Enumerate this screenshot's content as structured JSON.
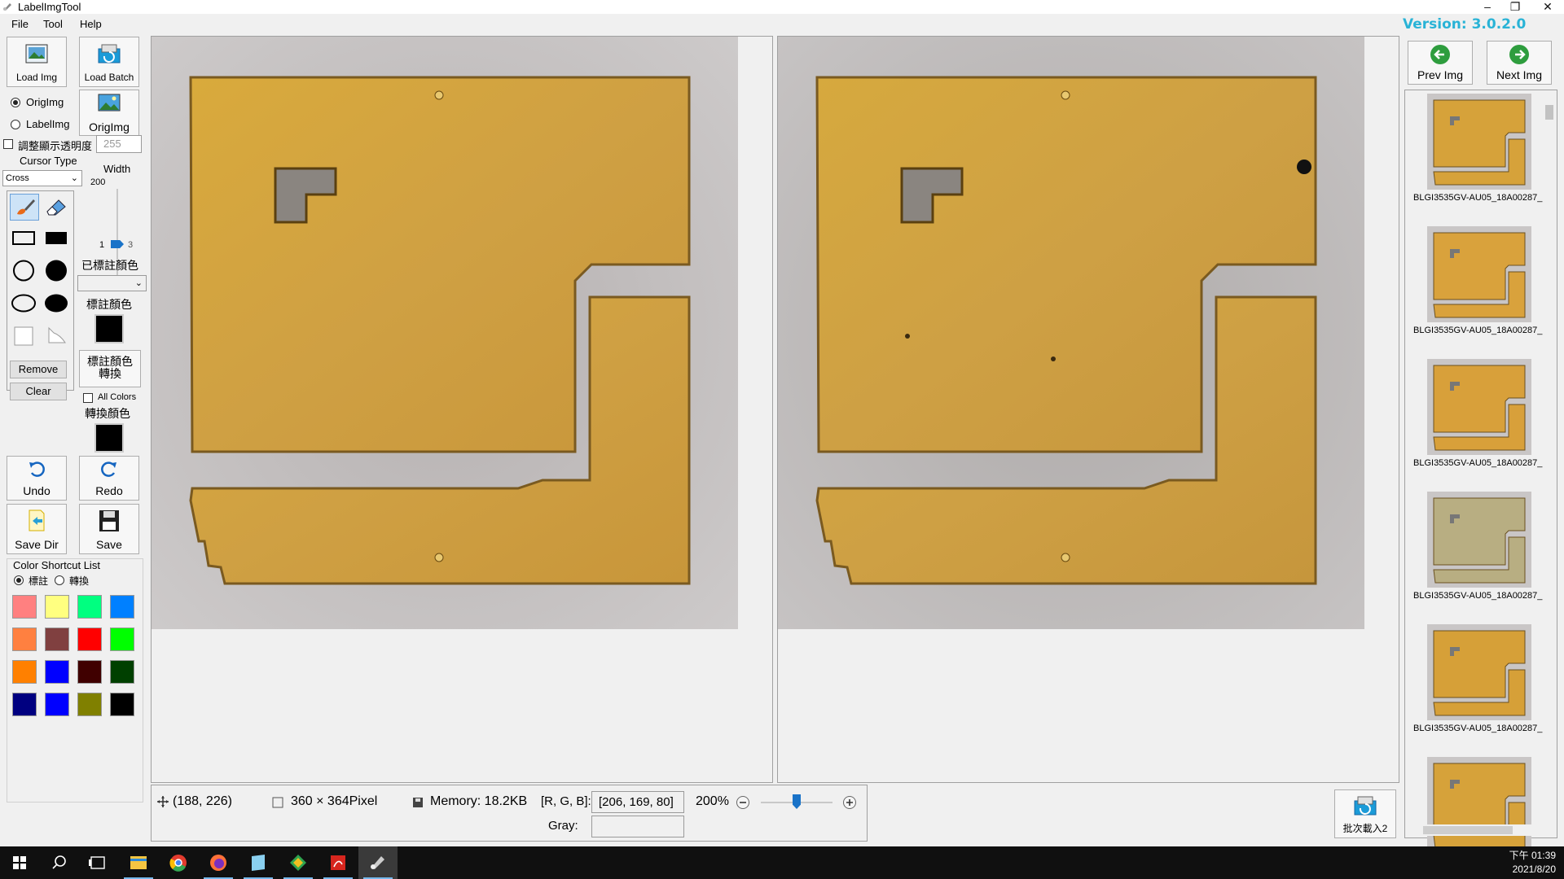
{
  "window": {
    "title": "LabelImgTool",
    "minimize": "–",
    "restore": "❐",
    "close": "✕"
  },
  "menu": [
    "File",
    "Tool",
    "Help"
  ],
  "version": "Version: 3.0.2.0",
  "left": {
    "load_img": "Load Img",
    "load_batch": "Load Batch",
    "radio_orig": "OrigImg",
    "radio_label": "LabelImg",
    "orig_btn": "OrigImg",
    "opacity_label": "調整顯示透明度",
    "opacity_value": "255",
    "cursor_type_label": "Cursor Type",
    "cursor_type_value": "Cross",
    "width_label": "Width",
    "width_max": "200",
    "width_min": "1",
    "width_value": "3",
    "labeled_color_label": "已標註顏色",
    "label_color_label": "標註顏色",
    "label_color": "#000000",
    "convert_btn_line1": "標註顏色",
    "convert_btn_line2": "轉換",
    "remove": "Remove",
    "clear": "Clear",
    "all_colors": "All Colors",
    "convert_color_label": "轉換顏色",
    "convert_color": "#000000",
    "undo": "Undo",
    "redo": "Redo",
    "save_dir": "Save Dir",
    "save": "Save",
    "shortcut_title": "Color Shortcut List",
    "shortcut_radio1": "標註",
    "shortcut_radio2": "轉換",
    "swatches": [
      "#ff8080",
      "#ffff80",
      "#00ff80",
      "#0080ff",
      "#ff8040",
      "#804040",
      "#ff0000",
      "#00ff00",
      "#ff8000",
      "#0000ff",
      "#400000",
      "#004000",
      "#000080",
      "#0000ff",
      "#808000",
      "#000000"
    ]
  },
  "status": {
    "coords": "(188, 226)",
    "size": "360 × 364Pixel",
    "memory": "Memory: 18.2KB",
    "rgb_label": "[R, G, B]:",
    "rgb_value": "[206, 169, 80]",
    "gray_label": "Gray:",
    "gray_value": "",
    "zoom": "200%",
    "zoom_level": 0.5
  },
  "right": {
    "prev": "Prev Img",
    "next": "Next Img",
    "batch_btn": "批次載入2",
    "thumbnails": [
      {
        "caption": "BLGI3535GV-AU05_18A00287_",
        "tint": "#d6a23a"
      },
      {
        "caption": "BLGI3535GV-AU05_18A00287_",
        "tint": "#d9a23c"
      },
      {
        "caption": "BLGI3535GV-AU05_18A00287_",
        "tint": "#d8a03a"
      },
      {
        "caption": "BLGI3535GV-AU05_18A00287_",
        "tint": "#b8ae82"
      },
      {
        "caption": "BLGI3535GV-AU05_18A00287_",
        "tint": "#d6a038"
      },
      {
        "caption": "",
        "tint": "#d6a23a"
      }
    ]
  },
  "taskbar": {
    "time": "下午 01:39",
    "date": "2021/8/20"
  },
  "icons": [
    "app-icon",
    "load-img-icon",
    "load-batch-icon",
    "orig-img-icon",
    "brush-icon",
    "eraser-icon",
    "rect-icon",
    "filled-rect-icon",
    "circle-icon",
    "filled-circle-icon",
    "ellipse-icon",
    "filled-ellipse-icon",
    "polygon-icon",
    "lasso-icon",
    "undo-icon",
    "redo-icon",
    "save-dir-icon",
    "save-icon",
    "prev-icon",
    "next-icon",
    "batch-load-icon",
    "move-icon",
    "image-size-icon",
    "memory-icon",
    "zoom-out-icon",
    "zoom-in-icon",
    "windows-icon",
    "search-icon",
    "task-view-icon",
    "explorer-icon",
    "chrome-icon",
    "firefox-icon",
    "notepad-icon",
    "git-icon",
    "acrobat-icon",
    "labelimg-icon"
  ]
}
